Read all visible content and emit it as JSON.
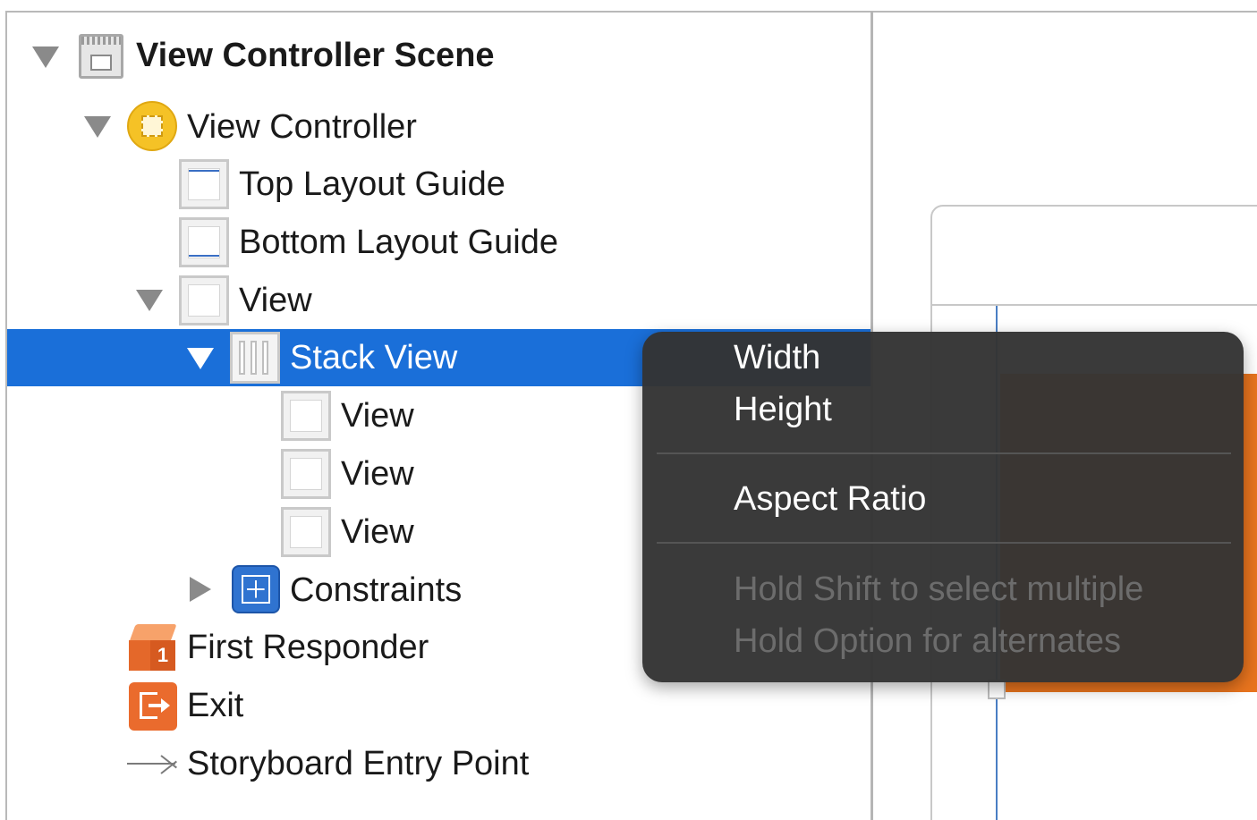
{
  "outline": {
    "scene_title": "View Controller Scene",
    "view_controller": "View Controller",
    "top_layout_guide": "Top Layout Guide",
    "bottom_layout_guide": "Bottom Layout Guide",
    "view": "View",
    "stack_view": "Stack View",
    "stack_children": [
      "View",
      "View",
      "View"
    ],
    "constraints": "Constraints",
    "first_responder": "First Responder",
    "exit": "Exit",
    "entry_point": "Storyboard Entry Point",
    "selected_item": "Stack View"
  },
  "constraint_menu": {
    "items": [
      "Width",
      "Height",
      "Aspect Ratio"
    ],
    "hints": [
      "Hold Shift to select multiple",
      "Hold Option for alternates"
    ]
  },
  "icons": {
    "disclosure_expanded": "triangle-down-icon",
    "disclosure_collapsed": "triangle-right-icon",
    "scene": "scene-icon",
    "view_controller": "view-controller-icon",
    "layout_guide": "layout-guide-icon",
    "view": "view-icon",
    "stack_view": "stack-view-icon",
    "constraints": "constraints-icon",
    "first_responder": "first-responder-icon",
    "exit": "exit-icon",
    "entry_point": "arrow-right-icon"
  },
  "colors": {
    "selection": "#1a6fd9",
    "menu_background": "#343434",
    "canvas_view": "#e8741e",
    "view_controller_icon": "#f5c226"
  }
}
